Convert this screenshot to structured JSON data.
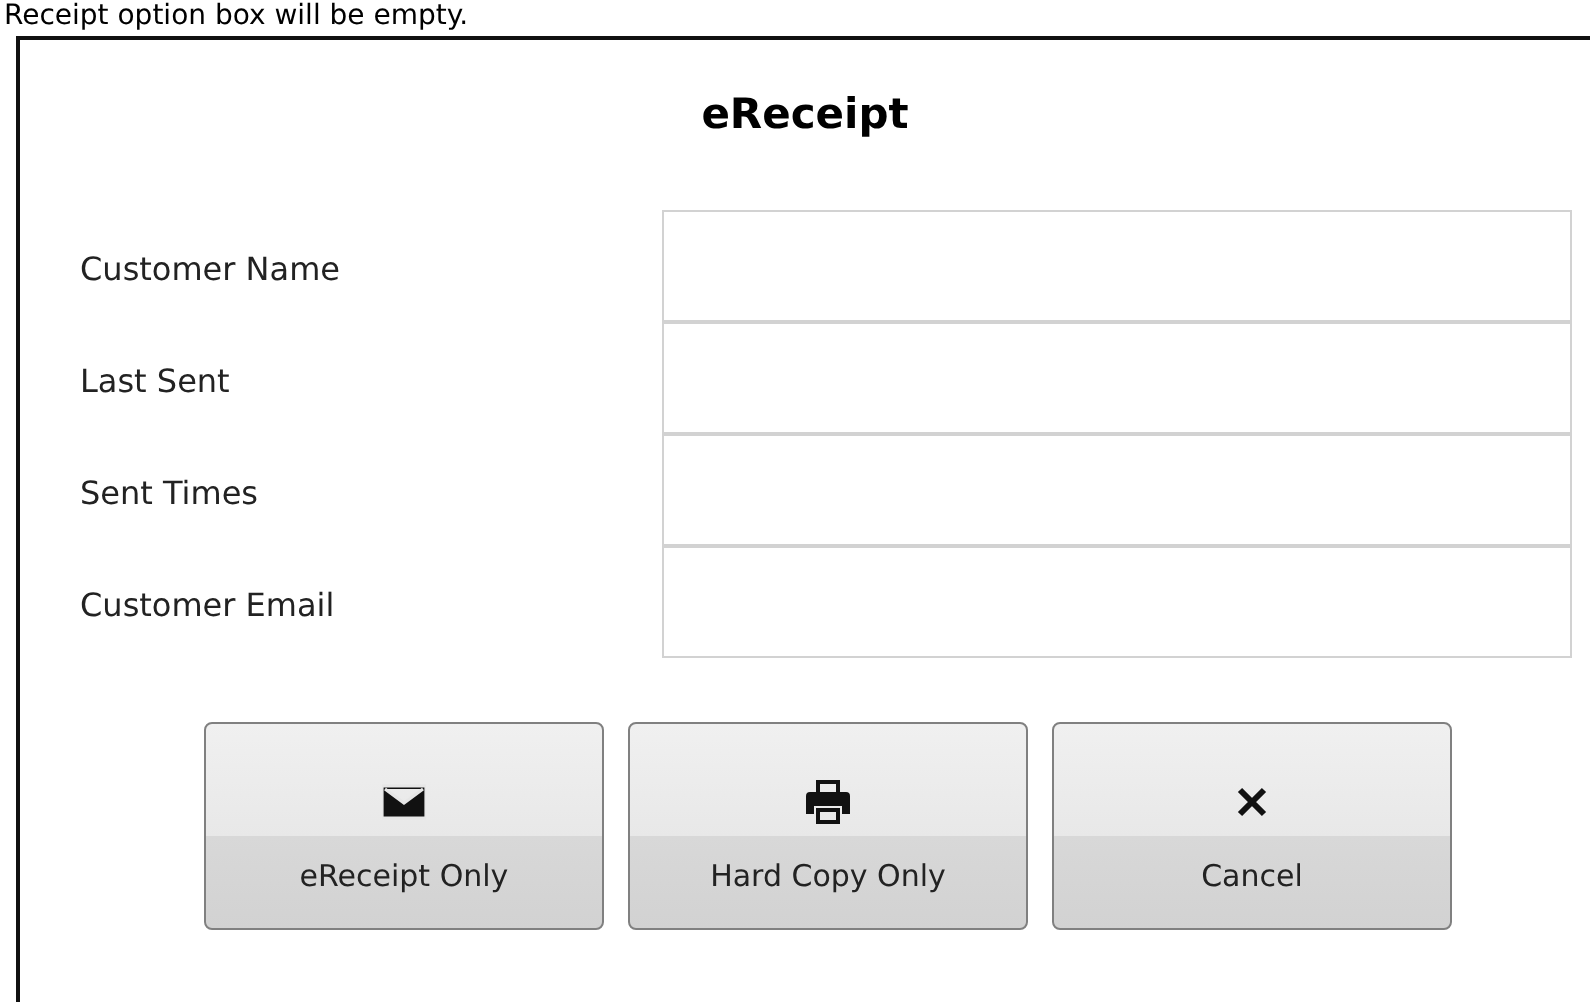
{
  "caption": "Receipt option box will be empty.",
  "dialog": {
    "title": "eReceipt",
    "fields": [
      {
        "label": "Customer Name"
      },
      {
        "label": "Last Sent"
      },
      {
        "label": "Sent Times"
      },
      {
        "label": "Customer Email"
      }
    ],
    "buttons": [
      {
        "kind": "envelope",
        "label": "eReceipt Only"
      },
      {
        "kind": "printer",
        "label": "Hard Copy Only"
      },
      {
        "kind": "close",
        "label": "Cancel"
      }
    ]
  }
}
